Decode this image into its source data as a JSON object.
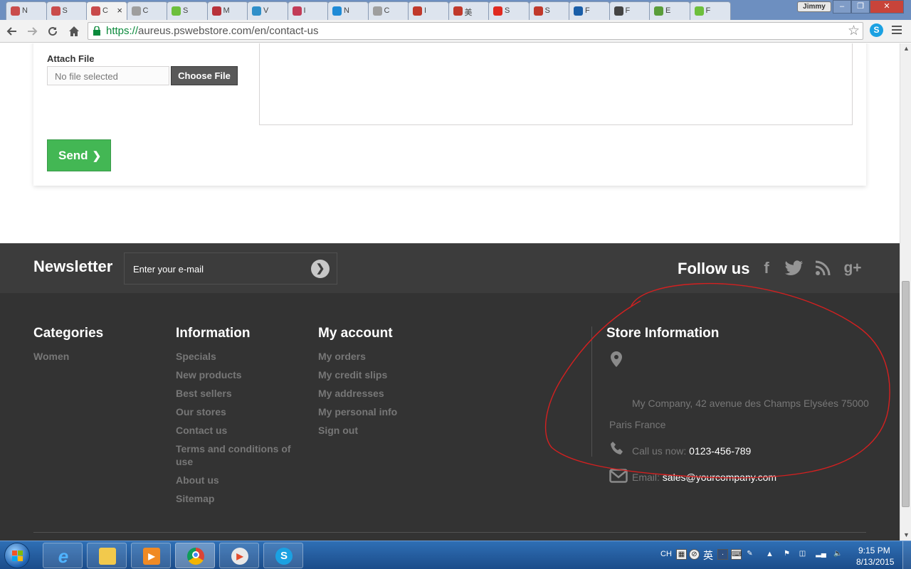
{
  "browser": {
    "tabs": [
      {
        "label": "N",
        "active": false,
        "favicon_color": "#c94b4b"
      },
      {
        "label": "S",
        "active": false,
        "favicon_color": "#c94b4b"
      },
      {
        "label": "C",
        "active": true,
        "favicon_color": "#c94b4b"
      },
      {
        "label": "C",
        "active": false,
        "favicon_color": "#9e9e9e"
      },
      {
        "label": "S",
        "active": false,
        "favicon_color": "#6dbf3c"
      },
      {
        "label": "M",
        "active": false,
        "favicon_color": "#b8323a"
      },
      {
        "label": "V",
        "active": false,
        "favicon_color": "#2f8fc9"
      },
      {
        "label": "I",
        "active": false,
        "favicon_color": "#c23b57"
      },
      {
        "label": "N",
        "active": false,
        "favicon_color": "#1e8ad6"
      },
      {
        "label": "C",
        "active": false,
        "favicon_color": "#9e9e9e"
      },
      {
        "label": "I",
        "active": false,
        "favicon_color": "#c0392b"
      },
      {
        "label": "美",
        "active": false,
        "favicon_color": "#c0392b"
      },
      {
        "label": "S",
        "active": false,
        "favicon_color": "#e02a20"
      },
      {
        "label": "S",
        "active": false,
        "favicon_color": "#c0392b"
      },
      {
        "label": "F",
        "active": false,
        "favicon_color": "#1a5ea8"
      },
      {
        "label": "F",
        "active": false,
        "favicon_color": "#444444"
      },
      {
        "label": "E",
        "active": false,
        "favicon_color": "#5a9d3a"
      },
      {
        "label": "F",
        "active": false,
        "favicon_color": "#6dbf3c"
      }
    ],
    "active_tab_close": "×",
    "user_badge": "Jimmy",
    "url_scheme": "https://",
    "url_rest": "aureus.pswebstore.com/en/contact-us"
  },
  "form": {
    "attach_label": "Attach File",
    "file_placeholder": "No file selected",
    "choose_file_label": "Choose File",
    "send_label": "Send"
  },
  "newsletter": {
    "title": "Newsletter",
    "input_placeholder": "Enter your e-mail",
    "follow_title": "Follow us",
    "social_icons": [
      "facebook-icon",
      "twitter-icon",
      "rss-icon",
      "google-plus-icon"
    ]
  },
  "footer": {
    "categories": {
      "title": "Categories",
      "items": [
        "Women"
      ]
    },
    "information": {
      "title": "Information",
      "items": [
        "Specials",
        "New products",
        "Best sellers",
        "Our stores",
        "Contact us",
        "Terms and conditions of use",
        "About us",
        "Sitemap"
      ]
    },
    "account": {
      "title": "My account",
      "items": [
        "My orders",
        "My credit slips",
        "My addresses",
        "My personal info",
        "Sign out"
      ]
    },
    "store": {
      "title": "Store Information",
      "address_line1": "My Company, 42 avenue des Champs Elysées 75000",
      "address_line2": "Paris France",
      "call_label": "Call us now: ",
      "phone": "0123-456-789",
      "email_label": "Email: ",
      "email": "sales@yourcompany.com"
    }
  },
  "taskbar": {
    "language": "CH",
    "ime_char": "英",
    "time": "9:15 PM",
    "date": "8/13/2015"
  },
  "colors": {
    "send_green": "#43b754",
    "footer_dark": "#333333",
    "newsletter_dark": "#3c3c3c",
    "annotation_red": "#d42020"
  }
}
